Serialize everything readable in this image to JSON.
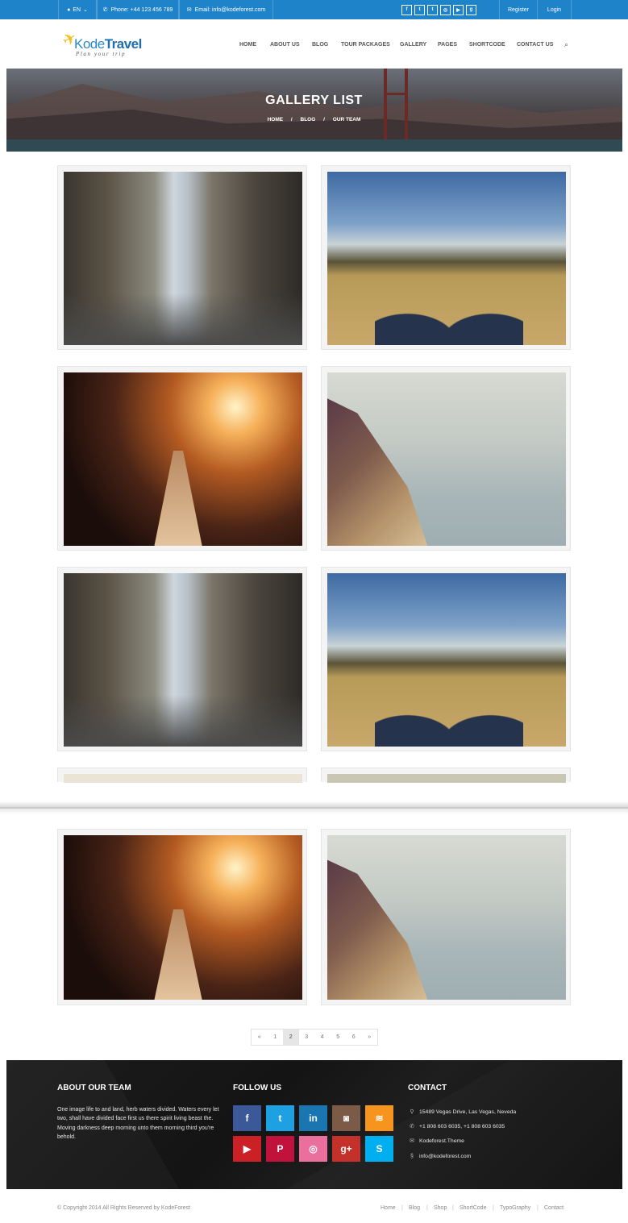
{
  "topbar": {
    "language": "EN",
    "phone": "Phone: +44 123 456 789",
    "email": "Email: info@kodeforest.com",
    "social_icons": [
      {
        "name": "facebook-icon",
        "glyph": "f"
      },
      {
        "name": "twitter-icon",
        "glyph": "t"
      },
      {
        "name": "tumblr-icon",
        "glyph": "t"
      },
      {
        "name": "dribbble-icon",
        "glyph": "◎"
      },
      {
        "name": "youtube-icon",
        "glyph": "▶"
      },
      {
        "name": "google-plus-icon",
        "glyph": "g"
      }
    ],
    "register": "Register",
    "login": "Login"
  },
  "header": {
    "logo_kode": "Kode",
    "logo_travel": "Travel",
    "logo_tagline": "Plan your trip",
    "nav": [
      "HOME",
      "ABOUT US",
      "BLOG",
      "TOUR PACKAGES",
      "GALLERY",
      "PAGES",
      "SHORTCODE",
      "CONTACT US"
    ],
    "search_icon": "search-icon"
  },
  "hero": {
    "title": "GALLERY LIST",
    "breadcrumb": [
      "HOME",
      "BLOG",
      "OUR TEAM"
    ],
    "separator": "/"
  },
  "gallery": {
    "images": [
      {
        "subject": "city-street"
      },
      {
        "subject": "feet-in-field"
      },
      {
        "subject": "sunset-train"
      },
      {
        "subject": "boat-bird"
      },
      {
        "subject": "city-street"
      },
      {
        "subject": "feet-in-field"
      },
      {
        "subject": "partial"
      },
      {
        "subject": "partial"
      },
      {
        "subject": "sunset-train"
      },
      {
        "subject": "boat-bird"
      }
    ]
  },
  "pagination": {
    "prev": "«",
    "pages": [
      "1",
      "2",
      "3",
      "4",
      "5",
      "6"
    ],
    "current": "2",
    "next": "»"
  },
  "footer": {
    "about_title": "ABOUT OUR TEAM",
    "about_text": "One image life to and land, herb waters divided. Waters every let two, shall have divided face first us there spirit living beast the. Moving darkness deep morning unto them morning third you're behold.",
    "follow_title": "FOLLOW US",
    "social": [
      {
        "name": "facebook",
        "glyph": "f",
        "color": "#3b5998"
      },
      {
        "name": "twitter",
        "glyph": "t",
        "color": "#1da1e2"
      },
      {
        "name": "linkedin",
        "glyph": "in",
        "color": "#1a76b1"
      },
      {
        "name": "instagram",
        "glyph": "◙",
        "color": "#7b5a47"
      },
      {
        "name": "rss",
        "glyph": "≋",
        "color": "#f7941e"
      },
      {
        "name": "youtube",
        "glyph": "▶",
        "color": "#cc2027"
      },
      {
        "name": "pinterest",
        "glyph": "P",
        "color": "#c0123a"
      },
      {
        "name": "dribbble",
        "glyph": "◎",
        "color": "#ea6f9c"
      },
      {
        "name": "google-plus",
        "glyph": "g+",
        "color": "#c3312a"
      },
      {
        "name": "skype",
        "glyph": "S",
        "color": "#00aff0"
      }
    ],
    "contact_title": "CONTACT",
    "contact": [
      {
        "icon": "map-pin-icon",
        "glyph": "⚲",
        "text": "15489 Vegas Drive, Las Vegas, Neveda"
      },
      {
        "icon": "phone-icon",
        "glyph": "✆",
        "text": "+1 808 603 6035, +1 808 603 6035"
      },
      {
        "icon": "mail-icon",
        "glyph": "✉",
        "text": "Kodeforest.Theme"
      },
      {
        "icon": "skype-icon",
        "glyph": "§",
        "text": "info@kodeforest.com"
      }
    ],
    "copyright": "© Copyright 2014 All Rights Reserved by KodeForest",
    "links": [
      "Home",
      "Blog",
      "Shop",
      "ShortCode",
      "TypoGraphy",
      "Contact"
    ]
  },
  "colors": {
    "topbar": "#1e83c8",
    "footer_bg": "#161616"
  }
}
